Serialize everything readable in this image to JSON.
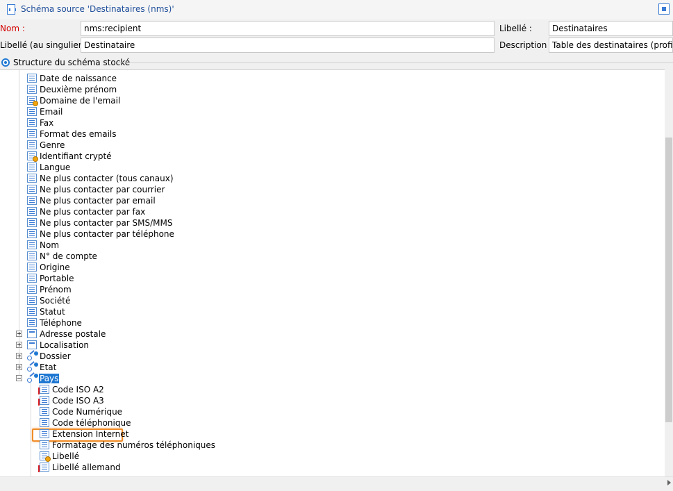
{
  "window": {
    "title": "Schéma source 'Destinataires (nms)'"
  },
  "form": {
    "nom_label": "Nom :",
    "nom_value": "nms:recipient",
    "libelle_label": "Libellé :",
    "libelle_value": "Destinataires",
    "libelle_singulier_label": "Libellé (au singulier) :",
    "libelle_singulier_value": "Destinataire",
    "description_label": "Description :",
    "description_value": "Table des destinataires (profils)"
  },
  "section": {
    "label": "Structure du schéma stocké"
  },
  "tree": {
    "items": [
      {
        "label": "Date de naissance",
        "icon": "attribute-icon"
      },
      {
        "label": "Deuxième prénom",
        "icon": "attribute-icon"
      },
      {
        "label": "Domaine de l'email",
        "icon": "computed-attribute-icon"
      },
      {
        "label": "Email",
        "icon": "attribute-icon"
      },
      {
        "label": "Fax",
        "icon": "attribute-icon"
      },
      {
        "label": "Format des emails",
        "icon": "attribute-icon"
      },
      {
        "label": "Genre",
        "icon": "attribute-icon"
      },
      {
        "label": "Identifiant crypté",
        "icon": "computed-attribute-icon"
      },
      {
        "label": "Langue",
        "icon": "attribute-icon"
      },
      {
        "label": "Ne plus contacter (tous canaux)",
        "icon": "attribute-icon"
      },
      {
        "label": "Ne plus contacter par courrier",
        "icon": "attribute-icon"
      },
      {
        "label": "Ne plus contacter par email",
        "icon": "attribute-icon"
      },
      {
        "label": "Ne plus contacter par fax",
        "icon": "attribute-icon"
      },
      {
        "label": "Ne plus contacter par SMS/MMS",
        "icon": "attribute-icon"
      },
      {
        "label": "Ne plus contacter par téléphone",
        "icon": "attribute-icon"
      },
      {
        "label": "Nom",
        "icon": "attribute-icon"
      },
      {
        "label": "N° de compte",
        "icon": "attribute-icon"
      },
      {
        "label": "Origine",
        "icon": "attribute-icon"
      },
      {
        "label": "Portable",
        "icon": "attribute-icon"
      },
      {
        "label": "Prénom",
        "icon": "attribute-icon"
      },
      {
        "label": "Société",
        "icon": "attribute-icon"
      },
      {
        "label": "Statut",
        "icon": "attribute-icon"
      },
      {
        "label": "Téléphone",
        "icon": "attribute-icon"
      },
      {
        "label": "Adresse postale",
        "icon": "element-icon",
        "expander": "plus"
      },
      {
        "label": "Localisation",
        "icon": "element-icon",
        "expander": "plus"
      },
      {
        "label": "Dossier",
        "icon": "link-icon",
        "expander": "plus"
      },
      {
        "label": "Etat",
        "icon": "link-icon",
        "expander": "plus"
      },
      {
        "label": "Pays",
        "icon": "link-icon",
        "expander": "minus",
        "selected": true
      },
      {
        "label": "Code ISO A2",
        "icon": "key-attribute-icon",
        "child": true
      },
      {
        "label": "Code ISO A3",
        "icon": "key-attribute-icon",
        "child": true
      },
      {
        "label": "Code Numérique",
        "icon": "attribute-icon",
        "child": true
      },
      {
        "label": "Code téléphonique",
        "icon": "attribute-icon",
        "child": true
      },
      {
        "label": "Extension Internet",
        "icon": "attribute-icon",
        "child": true,
        "highlighted": true
      },
      {
        "label": "Formatage des numéros téléphoniques",
        "icon": "attribute-icon",
        "child": true
      },
      {
        "label": "Libellé",
        "icon": "computed-attribute-icon",
        "child": true
      },
      {
        "label": "Libellé allemand",
        "icon": "key-attribute-icon",
        "child": true
      }
    ]
  },
  "colors": {
    "accent": "#1e78d2",
    "required_label": "#d40000",
    "highlight": "#f08c28"
  }
}
